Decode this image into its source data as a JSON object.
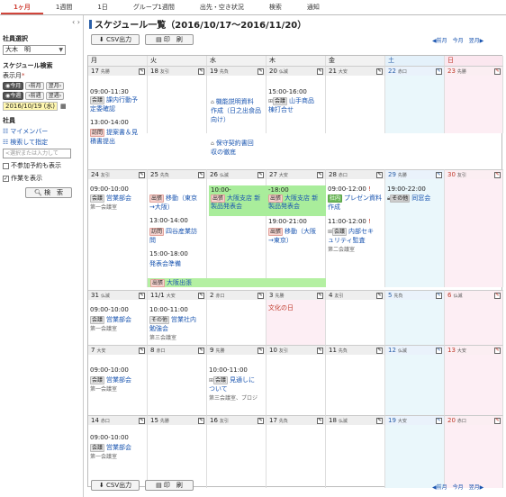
{
  "tabs": [
    "1ヶ月",
    "1週間",
    "1日",
    "グループ1週間",
    "出先・空き状況",
    "検索",
    "通知"
  ],
  "sidebar": {
    "employee_select": "社員選択",
    "employee_value": "大木　明",
    "schedule_search": "スケジュール検索",
    "display_month": "表示月",
    "display_month_mark": "*",
    "btn_this_month": "今月",
    "btn_prev_month": "前月",
    "btn_next_month": "翌月",
    "btn_today": "今週",
    "btn_prev_week": "前週",
    "btn_next_week": "翌週",
    "date": "2016/10/19 (水)",
    "employee": "社員",
    "my_member": "マイメンバー",
    "search_specify": "検索して指定",
    "search_placeholder": "<選択または入力して",
    "option_hidden": "不参加予約も表示",
    "option_work": "作業を表示",
    "search_button": "検　索"
  },
  "main": {
    "title": "スケジュール一覧（2016/10/17〜2016/11/20）",
    "csv": "CSV出力",
    "print": "印　刷",
    "prev": "前月",
    "this": "今月",
    "next": "翌月"
  },
  "weekdays": [
    "月",
    "火",
    "水",
    "木",
    "金",
    "土",
    "日"
  ],
  "calendar": {
    "w1": {
      "days": [
        "17",
        "18",
        "19",
        "20",
        "21",
        "22",
        "23"
      ],
      "ranks": [
        "先勝",
        "友引",
        "先負",
        "仏滅",
        "大安",
        "赤口",
        "先勝"
      ]
    },
    "w2": {
      "days": [
        "24",
        "25",
        "26",
        "27",
        "28",
        "29",
        "30"
      ],
      "ranks": [
        "友引",
        "先負",
        "仏滅",
        "大安",
        "赤口",
        "先勝",
        "友引"
      ]
    },
    "w3": {
      "days": [
        "31",
        "11/1",
        "2",
        "3",
        "4",
        "5",
        "6"
      ],
      "ranks": [
        "仏滅",
        "大安",
        "赤口",
        "先勝",
        "友引",
        "先負",
        "仏滅"
      ]
    },
    "w4": {
      "days": [
        "7",
        "8",
        "9",
        "10",
        "11",
        "12",
        "13"
      ],
      "ranks": [
        "大安",
        "赤口",
        "先勝",
        "友引",
        "先負",
        "仏滅",
        "大安"
      ]
    },
    "w5": {
      "days": [
        "14",
        "15",
        "16",
        "17",
        "18",
        "19",
        "20"
      ],
      "ranks": [
        "赤口",
        "先勝",
        "友引",
        "先負",
        "仏滅",
        "大安",
        "赤口"
      ]
    },
    "events": {
      "e1t": "09:00-11:30",
      "e1k": "会議",
      "e1a": "課内行動予",
      "e1b": "定委確認",
      "e2t": "13:00-14:00",
      "e2k": "訪問",
      "e2a": "提案書＆見",
      "e2b": "積書提出",
      "e3a": "機能説明資料",
      "e3b": "作成（日之出食品",
      "e3c": "向け）",
      "e4a": "保守契約書回",
      "e4b": "収の徹底",
      "e5t": "15:00-16:00",
      "e5k": "会議",
      "e5a": "山手商品",
      "e5b": "棟打合せ",
      "e6t": "09:00-10:00",
      "e6k": "会議",
      "e6a": "営業部会",
      "e6b": "第一会議室",
      "e7k": "出張",
      "e7a": "移動（東京",
      "e7b": "→大阪）",
      "e8t": "13:00-14:00",
      "e8k": "訪問",
      "e8a": "四谷産業訪",
      "e8b": "問",
      "e9t": "15:00-18:00",
      "e9a": "発表会準備",
      "e10t": "10:00-",
      "e10k": "出張",
      "e10a": "大阪支店 新",
      "e10b": "製品発表会",
      "e11t": "-18:00",
      "e11k": "出張",
      "e11a": "大阪支店 新",
      "e11b": "製品発表会",
      "e12t": "19:00-21:00",
      "e12k": "出張",
      "e12a": "移動（大阪",
      "e12b": "→東京）",
      "e13t": "09:00-12:00",
      "e13k": "社内",
      "e13a": "プレゼン資料",
      "e13b": "作成",
      "e14t": "11:00-12:00",
      "e14k": "会議",
      "e14a": "内部セキ",
      "e14b": "ュリティ監査",
      "e14c": "第二会議室",
      "e15t": "19:00-22:00",
      "e15k": "その他",
      "e15a": "同窓会",
      "e16k": "出張",
      "e16a": "大阪出張",
      "e17t": "09:00-10:00",
      "e17k": "会議",
      "e17a": "営業部会",
      "e17b": "第一会議室",
      "e18t": "10:00-11:00",
      "e18k": "その他",
      "e18a": "営業社内",
      "e18b": "勉強会",
      "e18c": "第三会議室",
      "e19a": "文化の日",
      "e20t": "09:00-10:00",
      "e20k": "会議",
      "e20a": "営業部会",
      "e20b": "第一会議室",
      "e21t": "10:00-11:00",
      "e21k": "会議",
      "e21a": "見通しに",
      "e21b": "ついて",
      "e21c": "第三会議室、プロジ",
      "e22t": "09:00-10:00",
      "e22k": "会議",
      "e22a": "営業部会",
      "e22b": "第一会議室"
    }
  }
}
